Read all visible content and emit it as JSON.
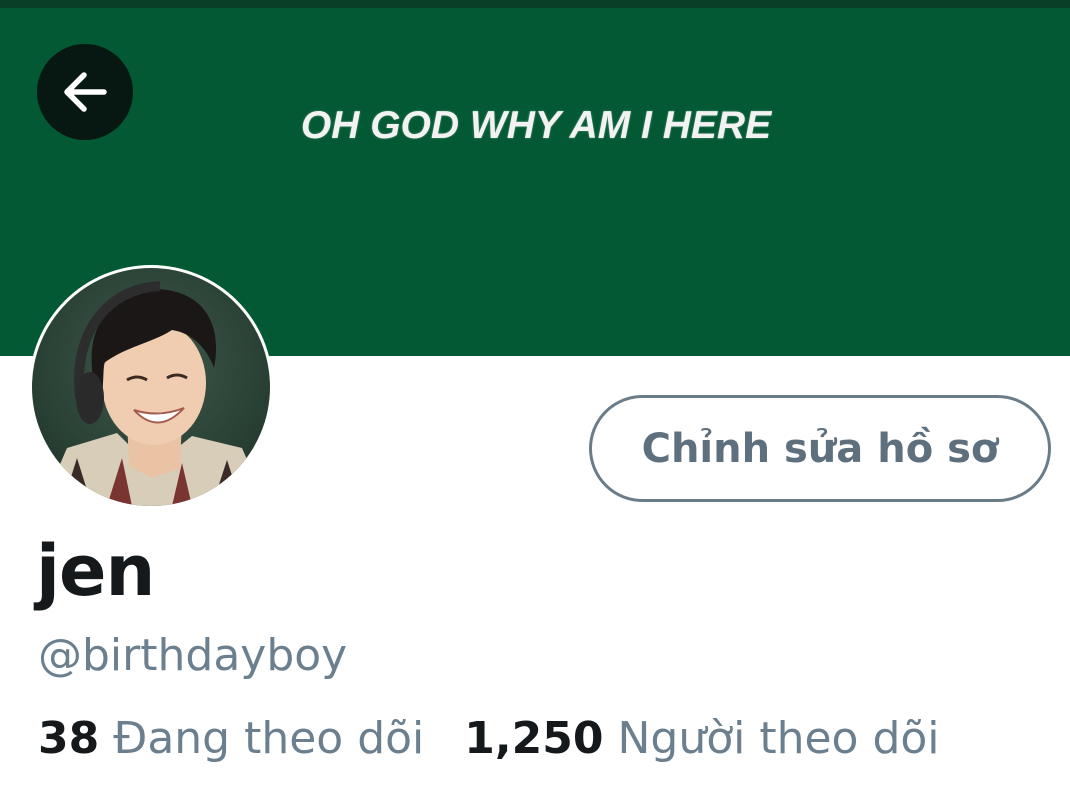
{
  "header": {
    "banner_text": "OH GOD WHY AM I HERE",
    "banner_color": "#035934",
    "back_icon": "arrow-left-icon"
  },
  "profile": {
    "name": "jen",
    "handle": "@birthdayboy",
    "edit_button_label": "Chỉnh sửa hồ sơ"
  },
  "stats": {
    "following_count": "38",
    "following_label": "Đang theo dõi",
    "followers_count": "1,250",
    "followers_label": "Người theo dõi"
  },
  "colors": {
    "text_primary": "#16191c",
    "text_secondary": "#6b7f8e",
    "button_border": "#6b7c89"
  }
}
